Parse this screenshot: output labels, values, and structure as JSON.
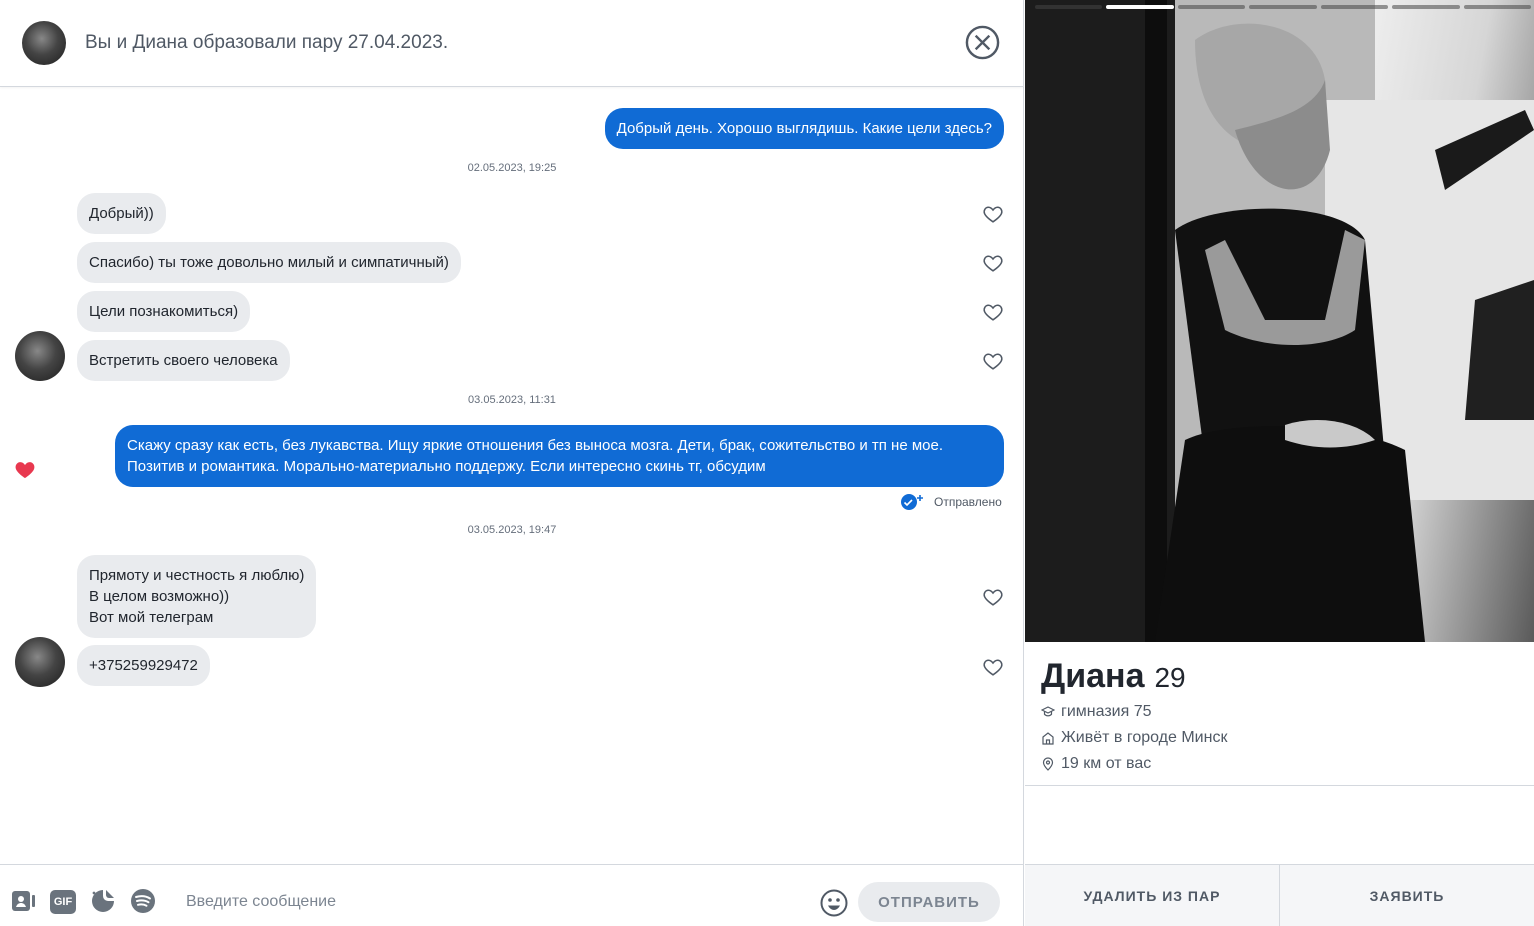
{
  "header": {
    "title": "Вы и Диана образовали пару 27.04.2023."
  },
  "messages": {
    "m1": "Добрый день. Хорошо выглядишь. Какие цели здесь?",
    "ts1": "02.05.2023, 19:25",
    "m2": "Добрый))",
    "m3": "Спасибо) ты тоже довольно милый и симпатичный)",
    "m4": "Цели познакомиться)",
    "m5": "Встретить своего человека",
    "ts2": "03.05.2023, 11:31",
    "m6": "Скажу сразу как есть, без лукавства. Ищу яркие отношения без выноса мозга. Дети, брак, сожительство и тп не мое.\nПозитив и романтика. Морально-материально поддержу. Если интересно скинь тг, обсудим",
    "delivered": "Отправлено",
    "ts3": "03.05.2023, 19:47",
    "m7": "Прямоту и честность я  люблю)\nВ целом возможно))\nВот мой телеграм",
    "m8": "+375259929472"
  },
  "composer": {
    "placeholder": "Введите сообщение",
    "send_label": "ОТПРАВИТЬ",
    "gif_label": "GIF"
  },
  "profile": {
    "name": "Диана",
    "age": "29",
    "school": "гимназия 75",
    "city": "Живёт в городе Минск",
    "distance": "19 км от вас",
    "photo_count": 7,
    "active_photo": 2
  },
  "actions": {
    "unmatch": "УДАЛИТЬ ИЗ ПАР",
    "report": "ЗАЯВИТЬ"
  },
  "colors": {
    "sent_bubble": "#106bd5",
    "recv_bubble": "#e9ebee",
    "heart_liked": "#e8384f"
  }
}
